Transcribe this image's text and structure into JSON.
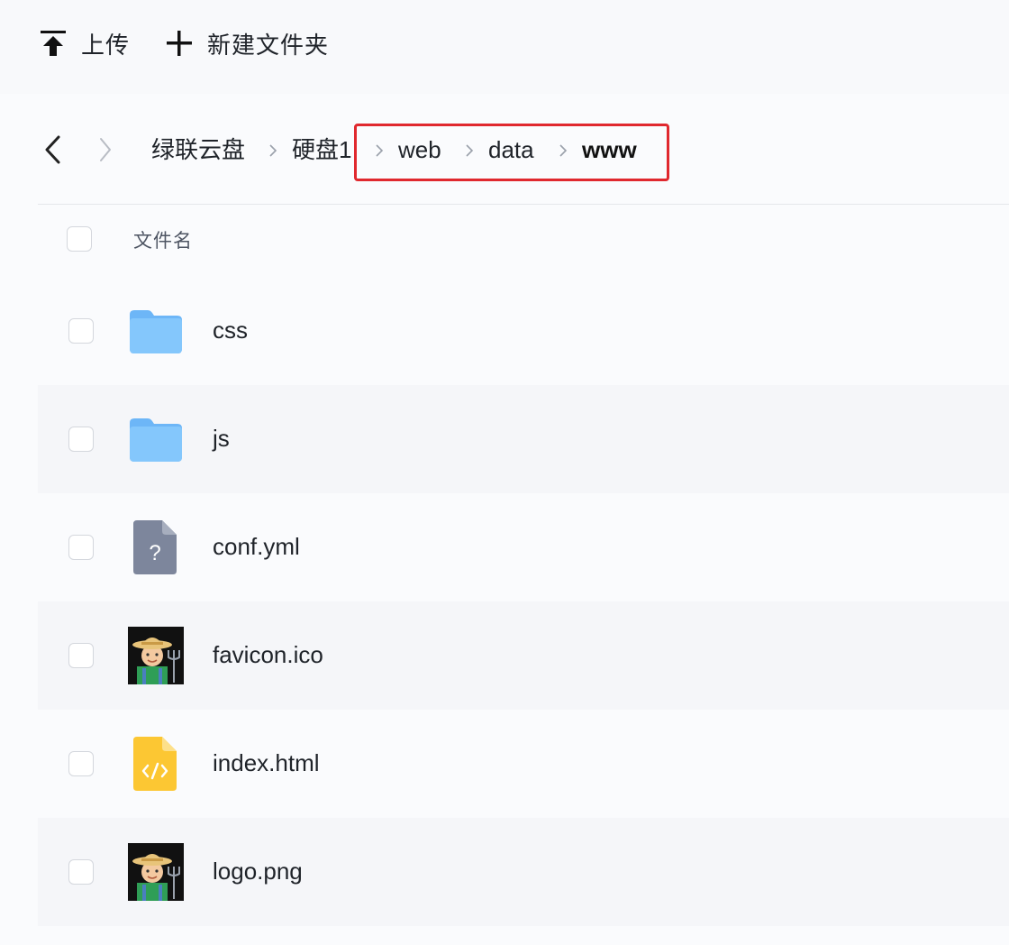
{
  "toolbar": {
    "upload_label": "上传",
    "new_folder_label": "新建文件夹"
  },
  "breadcrumb": {
    "items": [
      "绿联云盘",
      "硬盘1",
      "web",
      "data",
      "www"
    ]
  },
  "list": {
    "header_name": "文件名",
    "rows": [
      {
        "name": "css",
        "type": "folder"
      },
      {
        "name": "js",
        "type": "folder"
      },
      {
        "name": "conf.yml",
        "type": "unknown-file"
      },
      {
        "name": "favicon.ico",
        "type": "image"
      },
      {
        "name": "index.html",
        "type": "code-file"
      },
      {
        "name": "logo.png",
        "type": "image"
      }
    ]
  },
  "colors": {
    "highlight_border": "#e0282e",
    "folder": "#7ec3fb",
    "unknown_file": "#7d869c",
    "code_file": "#fcc733"
  }
}
